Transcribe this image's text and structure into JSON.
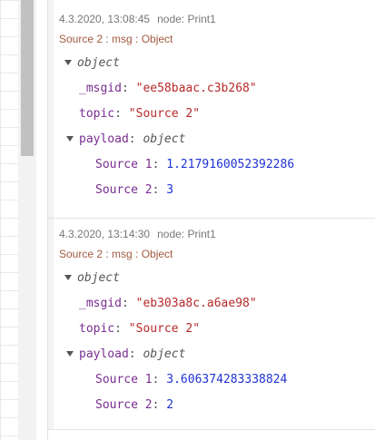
{
  "messages": [
    {
      "timestamp": "4.3.2020, 13:08:45",
      "node": "node: Print1",
      "topic_line": "Source 2 : msg : Object",
      "root_type": "object",
      "msgid_key": "_msgid",
      "msgid_value": "\"ee58baac.c3b268\"",
      "topic_key": "topic",
      "topic_value": "\"Source 2\"",
      "payload_key": "payload",
      "payload_type": "object",
      "items": [
        {
          "key": "Source 1",
          "value": "1.2179160052392286"
        },
        {
          "key": "Source 2",
          "value": "3"
        }
      ]
    },
    {
      "timestamp": "4.3.2020, 13:14:30",
      "node": "node: Print1",
      "topic_line": "Source 2 : msg : Object",
      "root_type": "object",
      "msgid_key": "_msgid",
      "msgid_value": "\"eb303a8c.a6ae98\"",
      "topic_key": "topic",
      "topic_value": "\"Source 2\"",
      "payload_key": "payload",
      "payload_type": "object",
      "items": [
        {
          "key": "Source 1",
          "value": "3.606374283338824"
        },
        {
          "key": "Source 2",
          "value": "2"
        }
      ]
    }
  ],
  "colors": {
    "key": "#792e90",
    "string": "#b72828",
    "number": "#2033d6",
    "topic_line": "#a35a3f"
  },
  "icons": {
    "caret": "caret-down-icon"
  }
}
